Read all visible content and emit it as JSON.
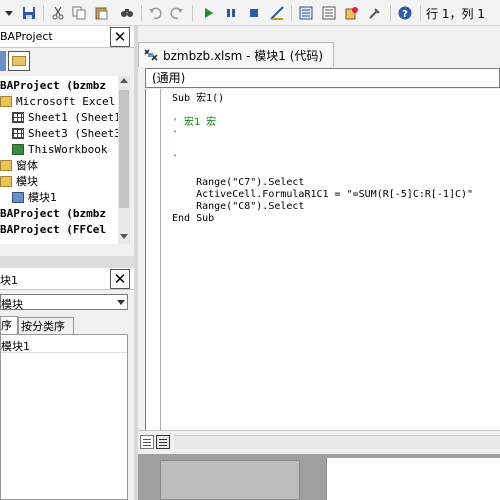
{
  "toolbar": {
    "buttons": [
      "dropdown-arrow",
      "save-icon",
      "cut-icon",
      "copy-icon",
      "paste-icon",
      "find-icon",
      "undo-icon",
      "redo-icon",
      "run-icon",
      "pause-icon",
      "stop-icon",
      "design-mode-icon",
      "project-explorer-icon",
      "properties-icon",
      "object-browser-icon",
      "toolbox-icon",
      "help-icon"
    ],
    "cursor_position": "行 1，列 1"
  },
  "project_explorer": {
    "title": "BAProject",
    "tree": [
      {
        "label": "BAProject (bzmbz",
        "icon": "project-icon",
        "bold": true
      },
      {
        "label": "Microsoft Excel 对",
        "icon": "folder-icon"
      },
      {
        "label": "Sheet1 (Sheet1",
        "icon": "sheet-icon"
      },
      {
        "label": "Sheet3 (Sheet3",
        "icon": "sheet-icon"
      },
      {
        "label": "ThisWorkbook",
        "icon": "workbook-icon"
      },
      {
        "label": "窗体",
        "icon": "folder-icon"
      },
      {
        "label": "模块",
        "icon": "folder-icon"
      },
      {
        "label": "模块1",
        "icon": "module-icon"
      },
      {
        "label": "BAProject (bzmbz",
        "icon": "project-icon",
        "bold": true
      },
      {
        "label": "BAProject (FFCel",
        "icon": "project-icon",
        "bold": true
      }
    ]
  },
  "properties": {
    "title": "块1",
    "object_select": "模块",
    "tabs": [
      "序",
      "按分类序"
    ],
    "name_row": {
      "key": "",
      "value": "模块1"
    }
  },
  "code_window": {
    "tab_title": "bzmbzb.xlsm - 模块1 (代码)",
    "object_combo": "(通用)",
    "code_lines": [
      {
        "text": "Sub 宏1()",
        "type": "code"
      },
      {
        "text": "",
        "type": "code"
      },
      {
        "text": "' 宏1 宏",
        "type": "comment"
      },
      {
        "text": "'",
        "type": "comment"
      },
      {
        "text": "",
        "type": "code"
      },
      {
        "text": "'",
        "type": "comment"
      },
      {
        "text": "",
        "type": "code"
      },
      {
        "text": "    Range(\"C7\").Select",
        "type": "code"
      },
      {
        "text": "    ActiveCell.FormulaR1C1 = \"=SUM(R[-5]C:R[-1]C)\"",
        "type": "code"
      },
      {
        "text": "    Range(\"C8\").Select",
        "type": "code"
      },
      {
        "text": "End Sub",
        "type": "code"
      }
    ]
  }
}
